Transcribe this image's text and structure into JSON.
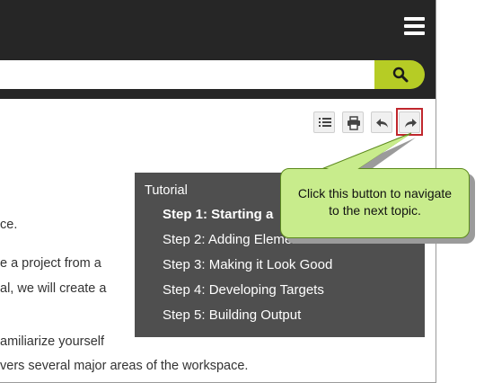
{
  "header": {
    "menu_icon": "hamburger-icon",
    "search": {
      "value": "",
      "placeholder": "",
      "button_icon": "search-icon"
    }
  },
  "toolbar": {
    "icons": [
      "list-icon",
      "print-icon",
      "back-arrow-icon",
      "forward-arrow-icon"
    ]
  },
  "content": {
    "lines": [
      "ce.",
      "e a project from a",
      "al, we will create a",
      "amiliarize yourself",
      "vers several major areas of the workspace."
    ]
  },
  "menu": {
    "title": "Tutorial",
    "items": [
      {
        "label": "Step 1: Starting a",
        "active": true
      },
      {
        "label": "Step 2: Adding Elements",
        "active": false
      },
      {
        "label": "Step 3: Making it Look Good",
        "active": false
      },
      {
        "label": "Step 4: Developing Targets",
        "active": false
      },
      {
        "label": "Step 5: Building Output",
        "active": false
      }
    ]
  },
  "callout": {
    "line1": "Click this button to navigate",
    "line2": "to the next topic."
  },
  "colors": {
    "header_bg": "#262626",
    "search_button": "#b6cc25",
    "menu_bg": "#4f4f4f",
    "callout_bg": "#c8ec8c",
    "highlight_border": "#c0272d"
  }
}
